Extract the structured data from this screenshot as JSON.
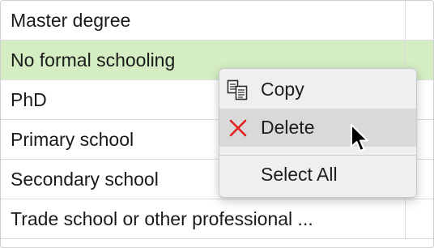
{
  "rows": [
    {
      "label": "Master degree"
    },
    {
      "label": "No formal schooling"
    },
    {
      "label": "PhD"
    },
    {
      "label": "Primary school"
    },
    {
      "label": "Secondary school"
    },
    {
      "label": "Trade school or other professional ..."
    }
  ],
  "selected_row": "No formal schooling",
  "context_menu": {
    "copy_label": "Copy",
    "copy_icon": "copy-icon",
    "delete_label": "Delete",
    "delete_icon": "delete-x-icon",
    "select_all_label": "Select All",
    "highlighted_item": "Delete"
  },
  "colors": {
    "selected_row": "#d4edc2",
    "delete_icon": "#e0211d",
    "menu_background": "#efefef",
    "menu_highlight": "#d9d9d9"
  }
}
